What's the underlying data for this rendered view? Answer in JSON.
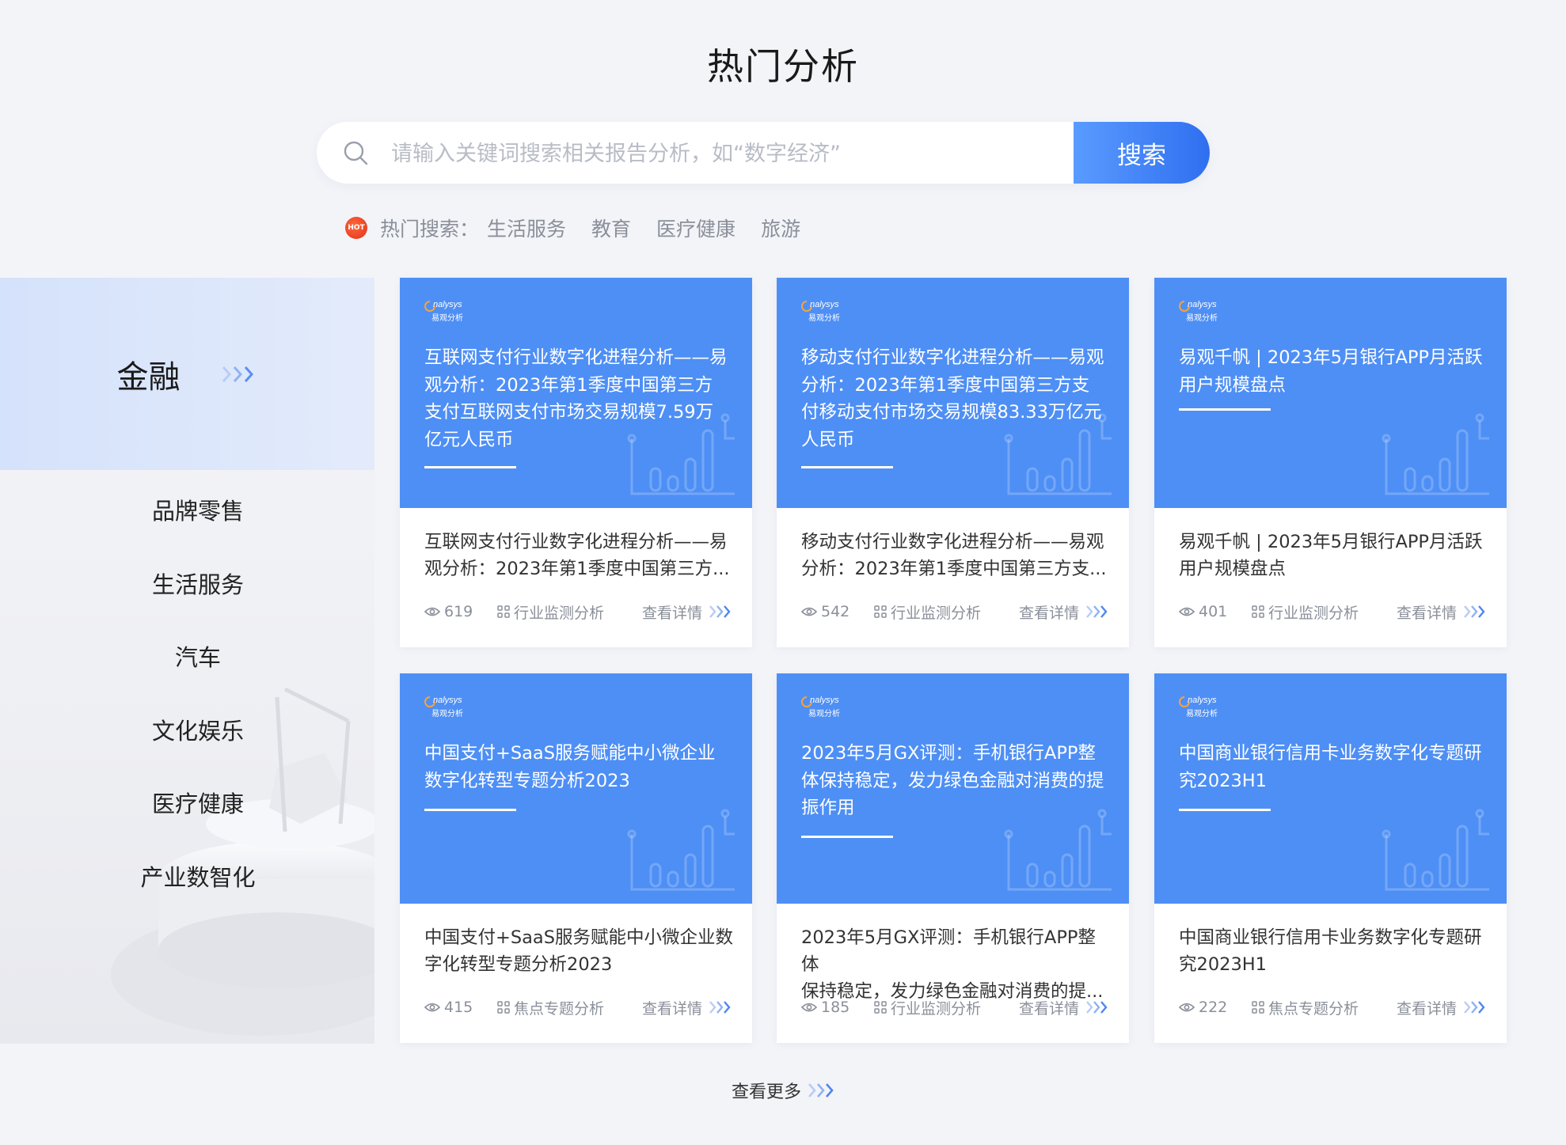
{
  "page": {
    "title": "热门分析"
  },
  "search": {
    "placeholder": "请输入关键词搜索相关报告分析，如“数字经济”",
    "button_label": "搜索"
  },
  "hot": {
    "label": "热门搜索：",
    "badge": "HOT",
    "tags": [
      "生活服务",
      "教育",
      "医疗健康",
      "旅游"
    ]
  },
  "sidebar": {
    "active": "金融",
    "items": [
      "品牌零售",
      "生活服务",
      "汽车",
      "文化娱乐",
      "医疗健康",
      "产业数智化"
    ]
  },
  "logo": {
    "top": "nalysys",
    "bottom": "易观分析"
  },
  "cards": [
    {
      "cover_title": "互联网支付行业数字化进程分析——易观分析：2023年第1季度中国第三方支付互联网支付市场交易规模7.59万亿元人民币",
      "desc_line1": "互联网支付行业数字化进程分析——易",
      "desc_line2": "观分析：2023年第1季度中国第三方...",
      "views": "619",
      "category": "行业监测分析",
      "detail": "查看详情"
    },
    {
      "cover_title": "移动支付行业数字化进程分析——易观分析：2023年第1季度中国第三方支付移动支付市场交易规模83.33万亿元人民币",
      "desc_line1": "移动支付行业数字化进程分析——易观",
      "desc_line2": "分析：2023年第1季度中国第三方支...",
      "views": "542",
      "category": "行业监测分析",
      "detail": "查看详情"
    },
    {
      "cover_title": "易观千帆 | 2023年5月银行APP月活跃用户规模盘点",
      "desc_line1": "易观千帆 | 2023年5月银行APP月活跃",
      "desc_line2": "用户规模盘点",
      "views": "401",
      "category": "行业监测分析",
      "detail": "查看详情"
    },
    {
      "cover_title": "中国支付+SaaS服务赋能中小微企业数字化转型专题分析2023",
      "desc_line1": "中国支付+SaaS服务赋能中小微企业数",
      "desc_line2": "字化转型专题分析2023",
      "views": "415",
      "category": "焦点专题分析",
      "detail": "查看详情"
    },
    {
      "cover_title": "2023年5月GX评测：手机银行APP整体保持稳定，发力绿色金融对消费的提振作用",
      "desc_line1": "2023年5月GX评测：手机银行APP整体",
      "desc_line2": "保持稳定，发力绿色金融对消费的提...",
      "views": "185",
      "category": "行业监测分析",
      "detail": "查看详情"
    },
    {
      "cover_title": "中国商业银行信用卡业务数字化专题研究2023H1",
      "desc_line1": "中国商业银行信用卡业务数字化专题研",
      "desc_line2": "究2023H1",
      "views": "222",
      "category": "焦点专题分析",
      "detail": "查看详情"
    }
  ],
  "more": {
    "label": "查看更多"
  },
  "colors": {
    "accent": "#4e8ff5",
    "button_start": "#5a9bff",
    "button_end": "#2f6ff0"
  }
}
